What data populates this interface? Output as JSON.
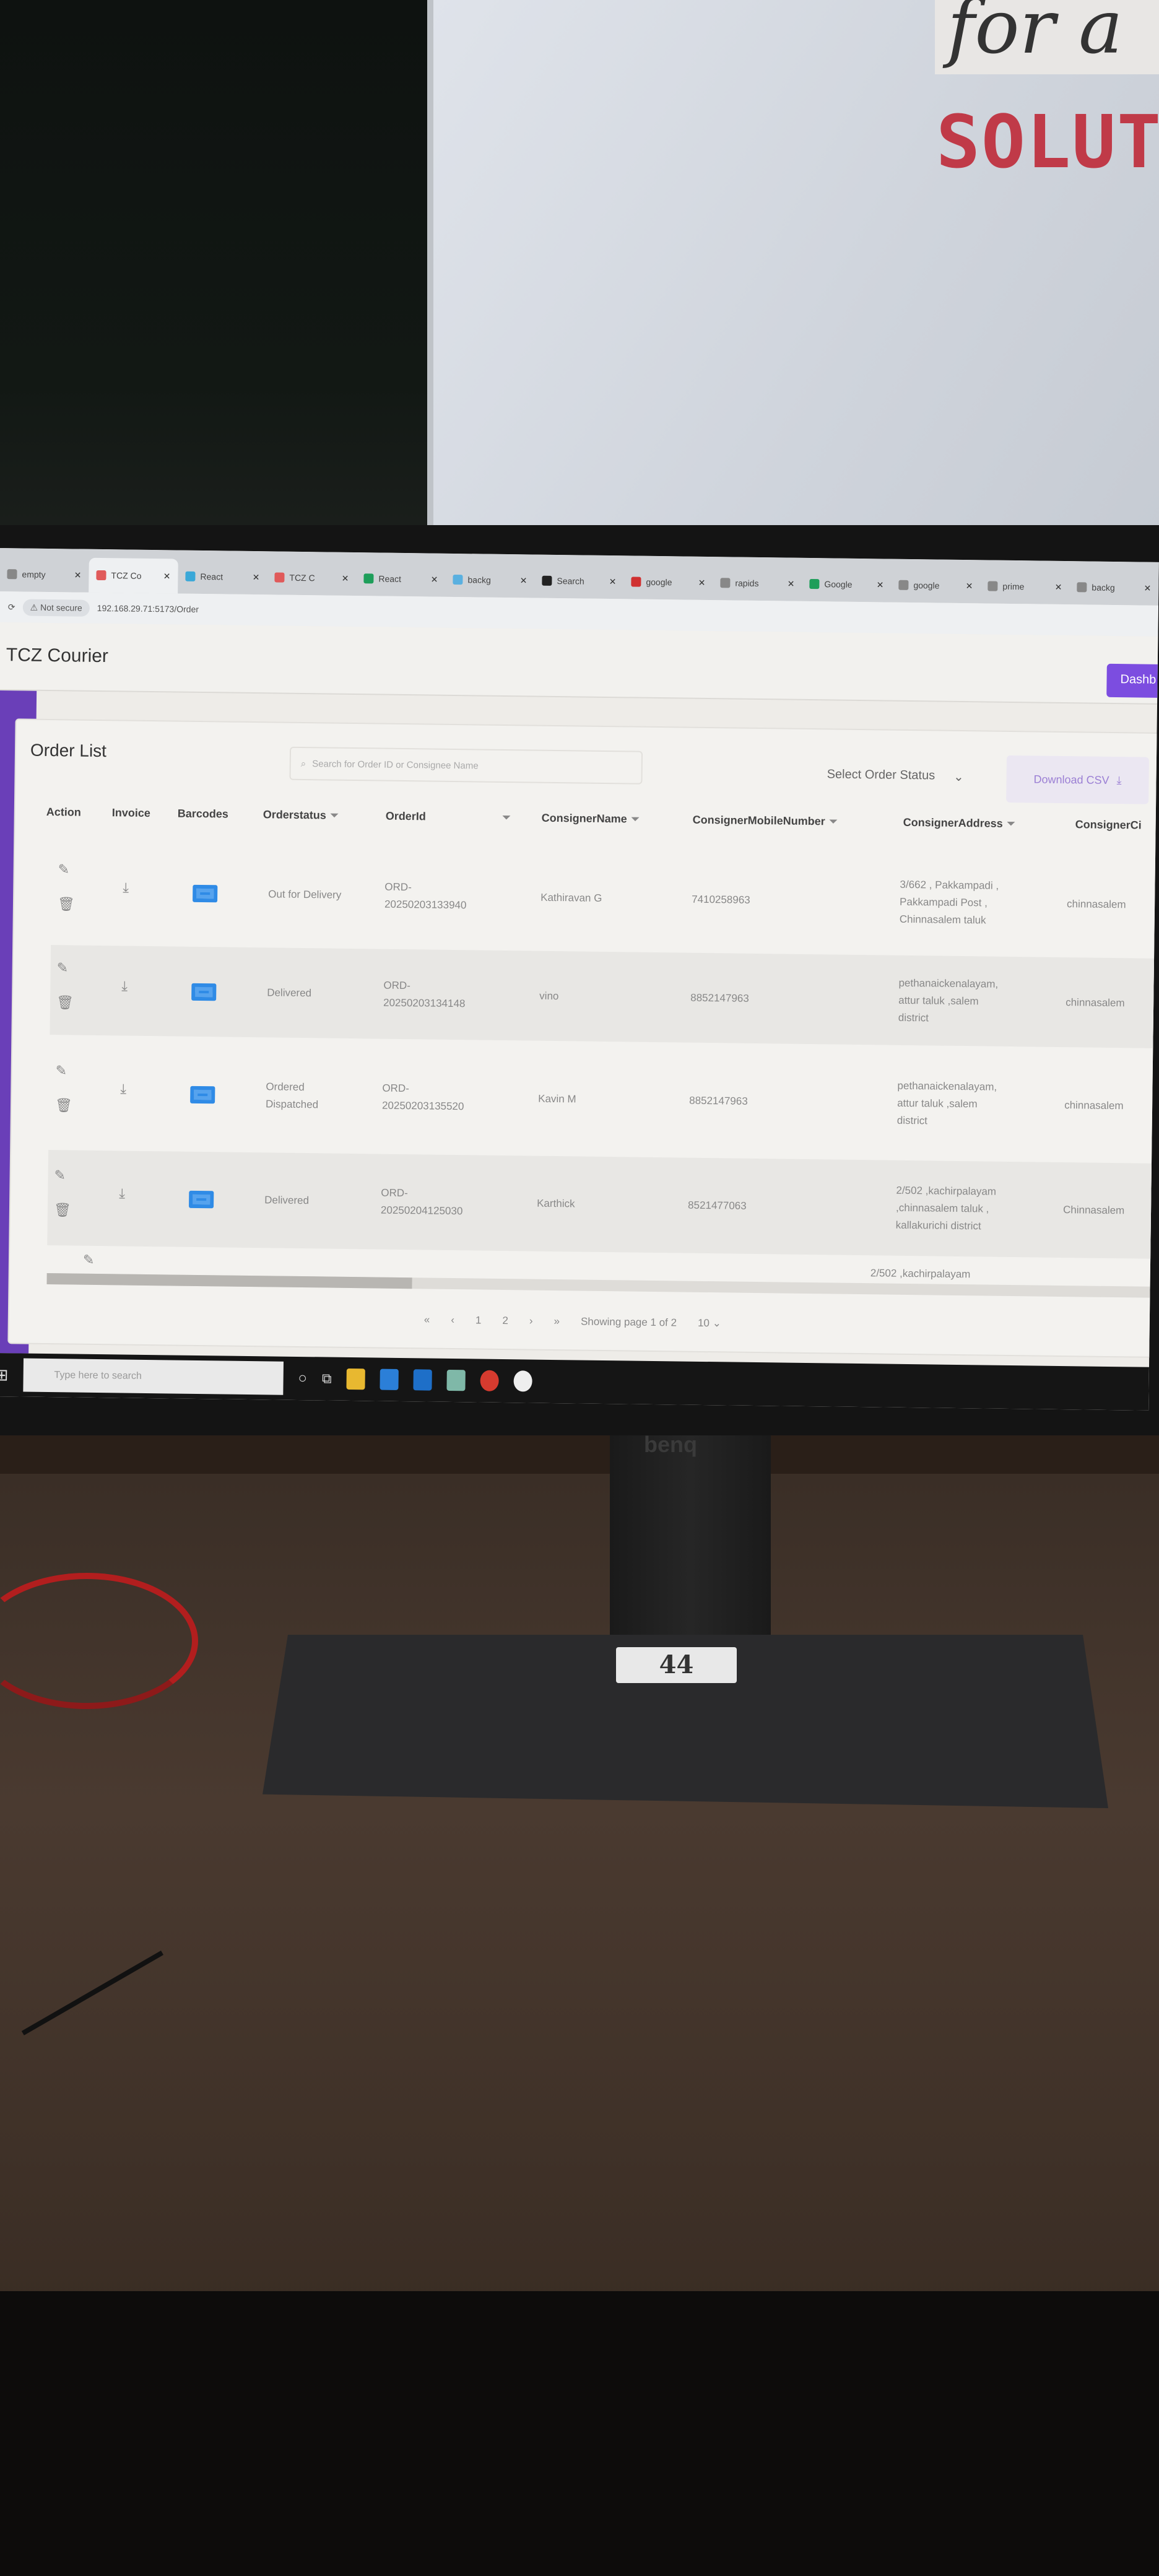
{
  "whiteboard": {
    "top_text": "for a",
    "brand_text": "SOLUTI"
  },
  "browser": {
    "tabs": [
      {
        "label": "empty",
        "color": "#888"
      },
      {
        "label": "TCZ Co",
        "color": "#e05a5a",
        "active": true
      },
      {
        "label": "React",
        "color": "#3aa8d8"
      },
      {
        "label": "TCZ C",
        "color": "#e05a5a"
      },
      {
        "label": "React",
        "color": "#1e9e5a"
      },
      {
        "label": "backg",
        "color": "#5ab0e0"
      },
      {
        "label": "Search",
        "color": "#222"
      },
      {
        "label": "google",
        "color": "#d03030"
      },
      {
        "label": "rapids",
        "color": "#888"
      },
      {
        "label": "Google",
        "color": "#1e9e5a"
      },
      {
        "label": "google",
        "color": "#888"
      },
      {
        "label": "prime",
        "color": "#888"
      },
      {
        "label": "backg",
        "color": "#888"
      }
    ],
    "security": "Not secure",
    "url": "192.168.29.71:5173/Order"
  },
  "app": {
    "title": "TCZ Courier",
    "dashboard_button": "Dashb"
  },
  "orders": {
    "title": "Order List",
    "search_placeholder": "Search for Order ID or Consignee Name",
    "status_select": "Select Order Status",
    "download_csv": "Download CSV",
    "columns": [
      "Action",
      "Invoice",
      "Barcodes",
      "Orderstatus",
      "OrderId",
      "ConsignerName",
      "ConsignerMobileNumber",
      "ConsignerAddress",
      "ConsignerCi"
    ],
    "rows": [
      {
        "status": "Out for Delivery",
        "order_id": "ORD-\n20250203133940",
        "name": "Kathiravan G",
        "mobile": "7410258963",
        "address": "3/662 , Pakkampadi ,\nPakkampadi Post ,\nChinnasalem taluk",
        "city": "chinnasalem"
      },
      {
        "status": "Delivered",
        "order_id": "ORD-\n20250203134148",
        "name": "vino",
        "mobile": "8852147963",
        "address": "pethanaickenalayam,\nattur taluk ,salem\ndistrict",
        "city": "chinnasalem"
      },
      {
        "status": "Ordered\nDispatched",
        "order_id": "ORD-\n20250203135520",
        "name": "Kavin M",
        "mobile": "8852147963",
        "address": "pethanaickenalayam,\nattur taluk ,salem\ndistrict",
        "city": "chinnasalem"
      },
      {
        "status": "Delivered",
        "order_id": "ORD-\n20250204125030",
        "name": "Karthick",
        "mobile": "8521477063",
        "address": "2/502 ,kachirpalayam\n,chinnasalem taluk ,\nkallakurichi district",
        "city": "Chinnasalem"
      }
    ],
    "partial_row_address": "2/502 ,kachirpalayam"
  },
  "pagination": {
    "first": "«",
    "prev": "‹",
    "pages": [
      "1",
      "2"
    ],
    "next": "›",
    "last": "»",
    "status": "Showing page 1 of 2",
    "page_size": "10"
  },
  "taskbar": {
    "search_placeholder": "Type here to search"
  },
  "monitor": {
    "brand": "benq",
    "label": "44"
  }
}
